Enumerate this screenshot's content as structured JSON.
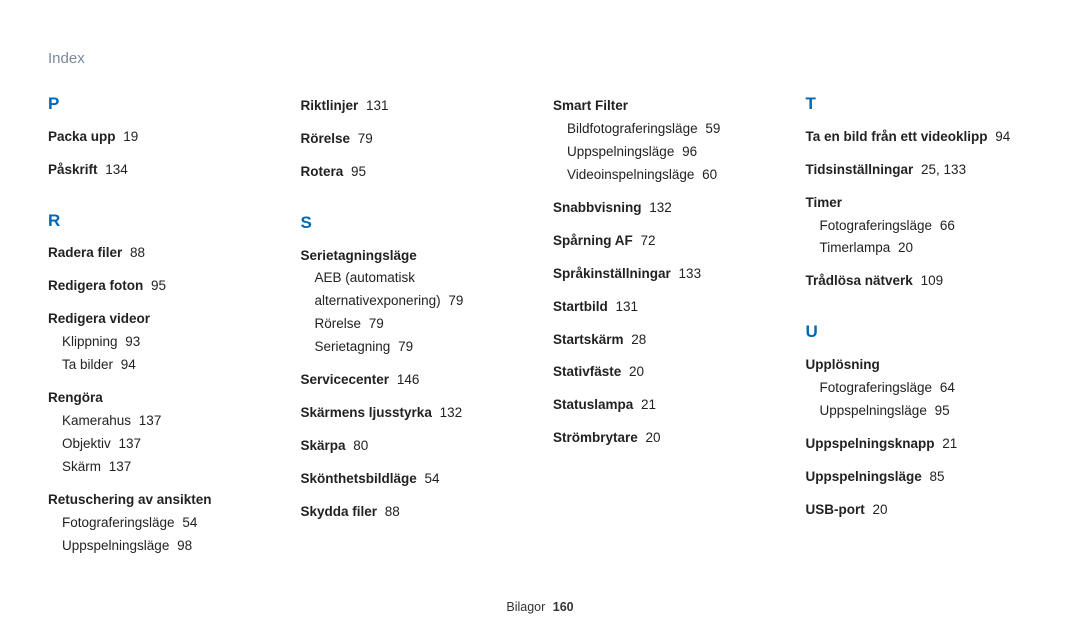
{
  "pageTitle": "Index",
  "footer": {
    "label": "Bilagor",
    "page": "160"
  },
  "columns": [
    {
      "blocks": [
        {
          "letter": "P",
          "groups": [
            {
              "title": "Packa upp",
              "pages": "19"
            },
            {
              "title": "Påskrift",
              "pages": "134"
            }
          ]
        },
        {
          "letter": "R",
          "groups": [
            {
              "title": "Radera filer",
              "pages": "88"
            },
            {
              "title": "Redigera foton",
              "pages": "95"
            },
            {
              "title": "Redigera videor",
              "subs": [
                {
                  "label": "Klippning",
                  "pages": "93"
                },
                {
                  "label": "Ta bilder",
                  "pages": "94"
                }
              ]
            },
            {
              "title": "Rengöra",
              "subs": [
                {
                  "label": "Kamerahus",
                  "pages": "137"
                },
                {
                  "label": "Objektiv",
                  "pages": "137"
                },
                {
                  "label": "Skärm",
                  "pages": "137"
                }
              ]
            },
            {
              "title": "Retuschering av ansikten",
              "subs": [
                {
                  "label": "Fotograferingsläge",
                  "pages": "54"
                },
                {
                  "label": "Uppspelningsläge",
                  "pages": "98"
                }
              ]
            }
          ]
        }
      ]
    },
    {
      "blocks": [
        {
          "groups": [
            {
              "title": "Riktlinjer",
              "pages": "131"
            },
            {
              "title": "Rörelse",
              "pages": "79"
            },
            {
              "title": "Rotera",
              "pages": "95"
            }
          ]
        },
        {
          "letter": "S",
          "groups": [
            {
              "title": "Serietagningsläge",
              "subs": [
                {
                  "label": "AEB (automatisk alternativexponering)",
                  "pages": "79"
                },
                {
                  "label": "Rörelse",
                  "pages": "79"
                },
                {
                  "label": "Serietagning",
                  "pages": "79"
                }
              ]
            },
            {
              "title": "Servicecenter",
              "pages": "146"
            },
            {
              "title": "Skärmens ljusstyrka",
              "pages": "132"
            },
            {
              "title": "Skärpa",
              "pages": "80"
            },
            {
              "title": "Skönthetsbildläge",
              "pages": "54"
            },
            {
              "title": "Skydda filer",
              "pages": "88"
            }
          ]
        }
      ]
    },
    {
      "blocks": [
        {
          "groups": [
            {
              "title": "Smart Filter",
              "subs": [
                {
                  "label": "Bildfotograferingsläge",
                  "pages": "59"
                },
                {
                  "label": "Uppspelningsläge",
                  "pages": "96"
                },
                {
                  "label": "Videoinspelningsläge",
                  "pages": "60"
                }
              ]
            },
            {
              "title": "Snabbvisning",
              "pages": "132"
            },
            {
              "title": "Spårning AF",
              "pages": "72"
            },
            {
              "title": "Språkinställningar",
              "pages": "133"
            },
            {
              "title": "Startbild",
              "pages": "131"
            },
            {
              "title": "Startskärm",
              "pages": "28"
            },
            {
              "title": "Stativfäste",
              "pages": "20"
            },
            {
              "title": "Statuslampa",
              "pages": "21"
            },
            {
              "title": "Strömbrytare",
              "pages": "20"
            }
          ]
        }
      ]
    },
    {
      "blocks": [
        {
          "letter": "T",
          "groups": [
            {
              "title": "Ta en bild från ett videoklipp",
              "pages": "94"
            },
            {
              "title": "Tidsinställningar",
              "pages": "25, 133"
            },
            {
              "title": "Timer",
              "subs": [
                {
                  "label": "Fotograferingsläge",
                  "pages": "66"
                },
                {
                  "label": "Timerlampa",
                  "pages": "20"
                }
              ]
            },
            {
              "title": "Trådlösa nätverk",
              "pages": "109"
            }
          ]
        },
        {
          "letter": "U",
          "groups": [
            {
              "title": "Upplösning",
              "subs": [
                {
                  "label": "Fotograferingsläge",
                  "pages": "64"
                },
                {
                  "label": "Uppspelningsläge",
                  "pages": "95"
                }
              ]
            },
            {
              "title": "Uppspelningsknapp",
              "pages": "21"
            },
            {
              "title": "Uppspelningsläge",
              "pages": "85"
            },
            {
              "title": "USB-port",
              "pages": "20"
            }
          ]
        }
      ]
    }
  ]
}
